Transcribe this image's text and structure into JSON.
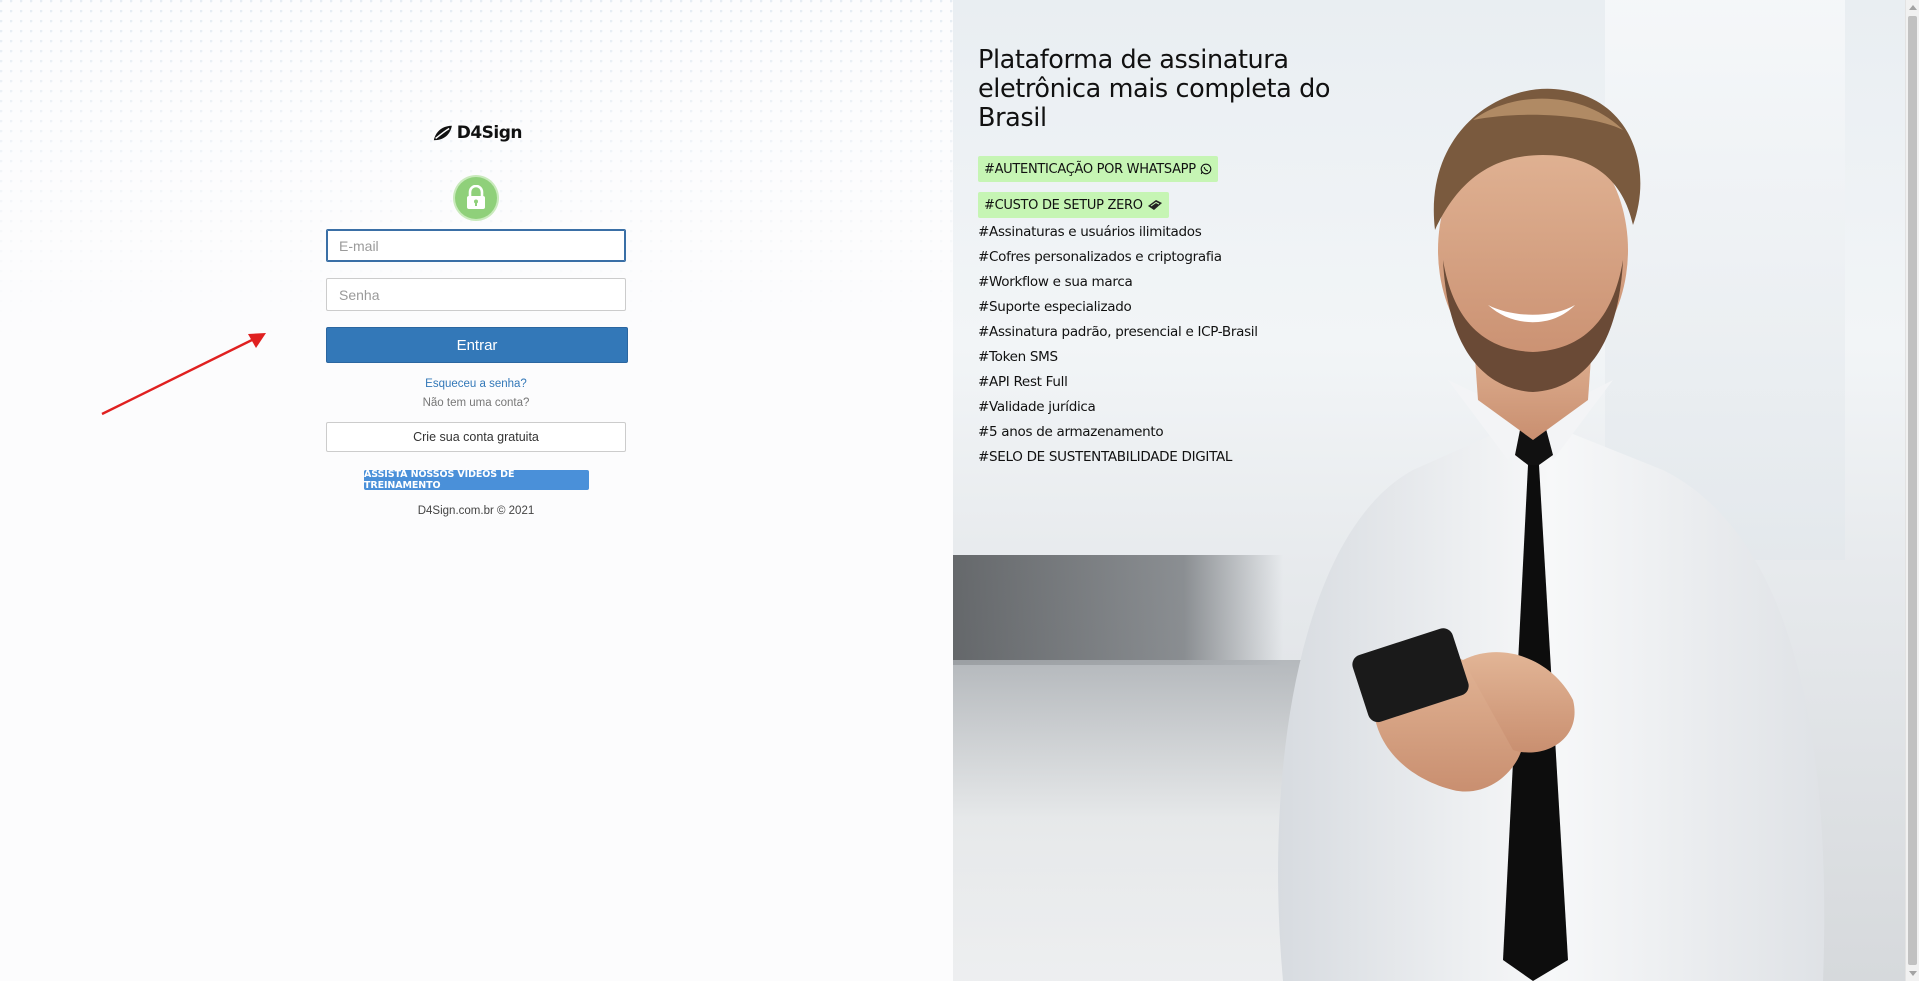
{
  "brand": {
    "name": "D4Sign",
    "logo_icon": "leaf-logo-icon"
  },
  "login": {
    "lock_icon": "padlock-icon",
    "email_placeholder": "E-mail",
    "password_placeholder": "Senha",
    "submit_label": "Entrar",
    "forgot_label": "Esqueceu a senha?",
    "no_account_text": "Não tem uma conta?",
    "create_account_label": "Crie sua conta gratuita",
    "videos_label": "ASSISTA NOSSOS VÍDEOS DE TREINAMENTO",
    "copyright": "D4Sign.com.br © 2021"
  },
  "promo": {
    "headline": "Plataforma de assinatura eletrônica mais completa do Brasil",
    "highlight_tags": [
      {
        "label": "#AUTENTICAÇÃO POR WHATSAPP",
        "icon": "whatsapp-icon"
      },
      {
        "label": "#CUSTO DE SETUP ZERO",
        "icon": "money-icon"
      }
    ],
    "features": [
      "#Assinaturas e usuários ilimitados",
      "#Cofres personalizados e criptografia",
      "#Workflow e sua marca",
      "#Suporte especializado",
      "#Assinatura padrão, presencial e ICP-Brasil",
      "#Token SMS",
      "#API Rest Full",
      "#Validade jurídica",
      "#5 anos de armazenamento",
      "#SELO DE SUSTENTABILIDADE DIGITAL"
    ]
  },
  "colors": {
    "primary": "#3378b8",
    "tag_highlight": "#c6f5b4",
    "lock_green": "#8fd07a",
    "annotation_arrow": "#e02020"
  }
}
